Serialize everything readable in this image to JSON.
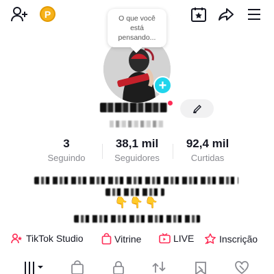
{
  "thought_bubble": {
    "text": "O que você está pensando..."
  },
  "profile": {
    "stats": [
      {
        "value": "3",
        "label": "Seguindo"
      },
      {
        "value": "38,1 mil",
        "label": "Seguidores"
      },
      {
        "value": "92,4 mil",
        "label": "Curtidas"
      }
    ],
    "bio_emojis": "👇👇👇"
  },
  "quick_links": [
    {
      "label": "TikTok Studio",
      "icon": "studio-icon"
    },
    {
      "label": "Vitrine",
      "icon": "shopping-bag-icon"
    },
    {
      "label": "LIVE",
      "icon": "live-tv-icon"
    },
    {
      "label": "Inscrição",
      "icon": "subscription-star-icon"
    }
  ],
  "colors": {
    "accent": "#fe2c55",
    "badge": "#20d5ec",
    "coin": "#f6b21a"
  }
}
